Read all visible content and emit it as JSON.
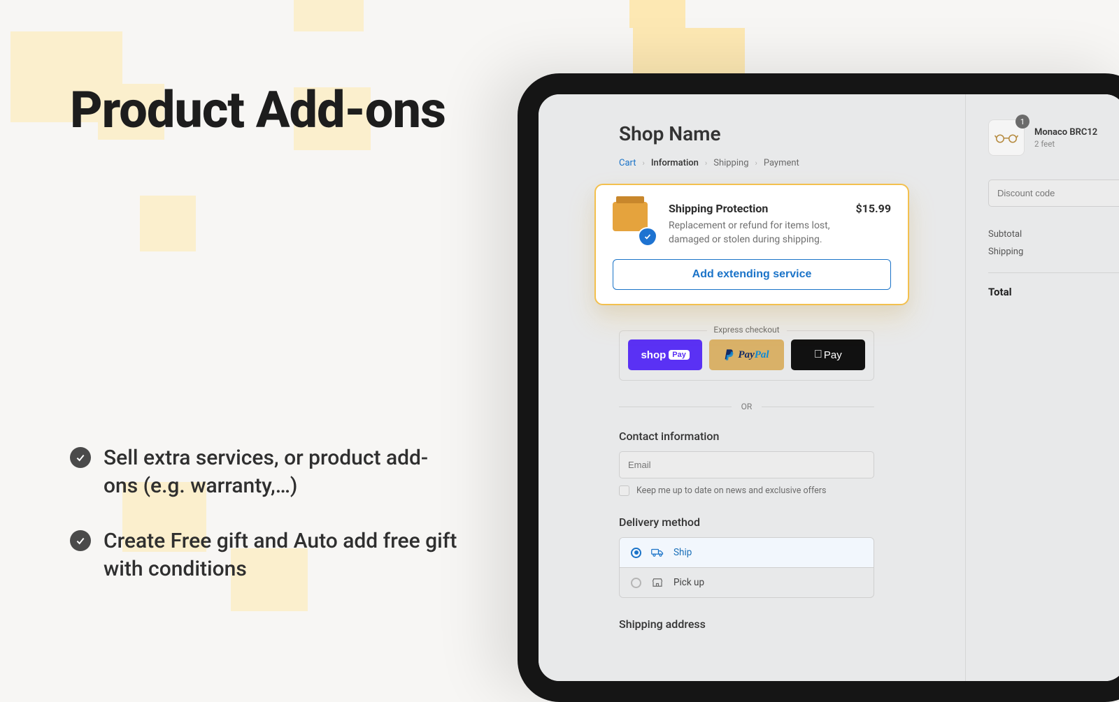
{
  "hero": {
    "title": "Product Add-ons",
    "bullets": [
      "Sell extra services, or product add-ons (e.g. warranty,…)",
      "Create Free gift and Auto add free gift with conditions"
    ]
  },
  "checkout": {
    "shop_name": "Shop Name",
    "breadcrumbs": {
      "cart": "Cart",
      "information": "Information",
      "shipping": "Shipping",
      "payment": "Payment"
    },
    "addon": {
      "title": "Shipping Protection",
      "description": "Replacement or refund for items lost, damaged or stolen during shipping.",
      "price": "$15.99",
      "cta": "Add extending service"
    },
    "express": {
      "label": "Express checkout",
      "shoppay": "shop",
      "shoppay_pill": "Pay",
      "paypal_a": "Pay",
      "paypal_b": "Pal",
      "applepay": "Pay"
    },
    "or": "OR",
    "contact": {
      "title": "Contact information",
      "email_placeholder": "Email",
      "optin": "Keep me up to date on news and exclusive offers"
    },
    "delivery": {
      "title": "Delivery method",
      "ship": "Ship",
      "pickup": "Pick up"
    },
    "shipping_address_title": "Shipping address"
  },
  "cart": {
    "item": {
      "name": "Monaco BRC12",
      "subtitle": "2 feet",
      "qty": "1"
    },
    "discount_placeholder": "Discount code",
    "summary": {
      "subtotal_label": "Subtotal",
      "shipping_label": "Shipping",
      "total_label": "Total"
    }
  }
}
